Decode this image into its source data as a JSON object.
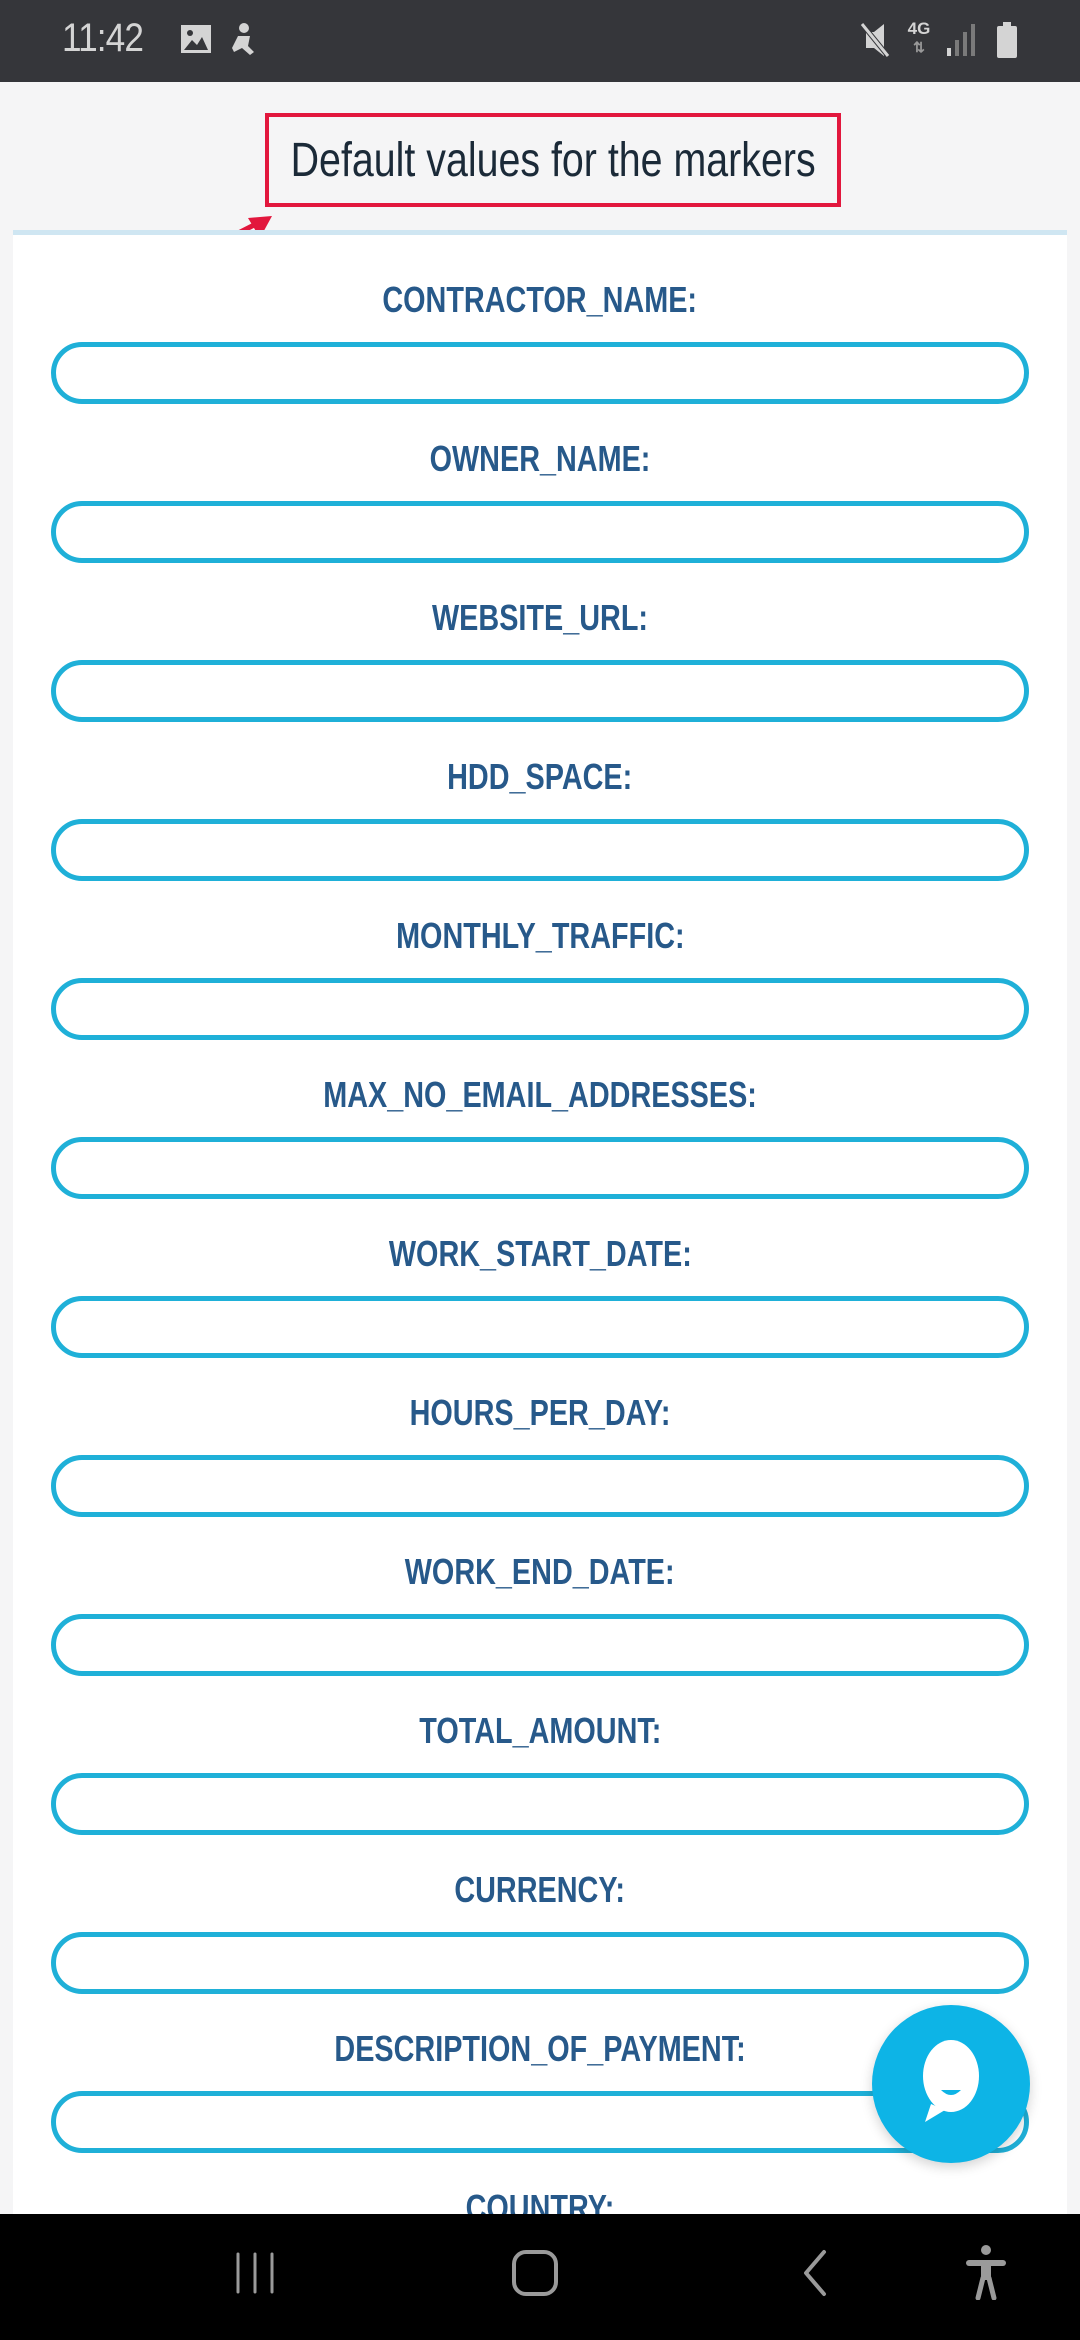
{
  "status_bar": {
    "time": "11:42",
    "left_icons": [
      "gallery-icon",
      "accessibility-service-icon"
    ],
    "right_icons": [
      "mute-icon",
      "4g-data-icon",
      "signal-icon",
      "battery-icon"
    ],
    "network_label": "4G"
  },
  "header": {
    "title": "Default values for the markers",
    "highlight_color": "#e2173d"
  },
  "form": {
    "fields": [
      {
        "label": "CONTRACTOR_NAME:",
        "value": ""
      },
      {
        "label": "OWNER_NAME:",
        "value": ""
      },
      {
        "label": "WEBSITE_URL:",
        "value": ""
      },
      {
        "label": "HDD_SPACE:",
        "value": ""
      },
      {
        "label": "MONTHLY_TRAFFIC:",
        "value": ""
      },
      {
        "label": "MAX_NO_EMAIL_ADDRESSES:",
        "value": ""
      },
      {
        "label": "WORK_START_DATE:",
        "value": ""
      },
      {
        "label": "HOURS_PER_DAY:",
        "value": ""
      },
      {
        "label": "WORK_END_DATE:",
        "value": ""
      },
      {
        "label": "TOTAL_AMOUNT:",
        "value": ""
      },
      {
        "label": "CURRENCY:",
        "value": ""
      },
      {
        "label": "DESCRIPTION_OF_PAYMENT:",
        "value": ""
      },
      {
        "label": "COUNTRY:",
        "value": ""
      }
    ],
    "label_color": "#27598a",
    "input_border_color": "#1fb0d8"
  },
  "chat_button": {
    "icon": "chat-bubble-icon",
    "color": "#0db4e6"
  },
  "nav_bar": {
    "items": [
      "recent-apps-icon",
      "home-icon",
      "back-icon",
      "accessibility-icon"
    ]
  }
}
